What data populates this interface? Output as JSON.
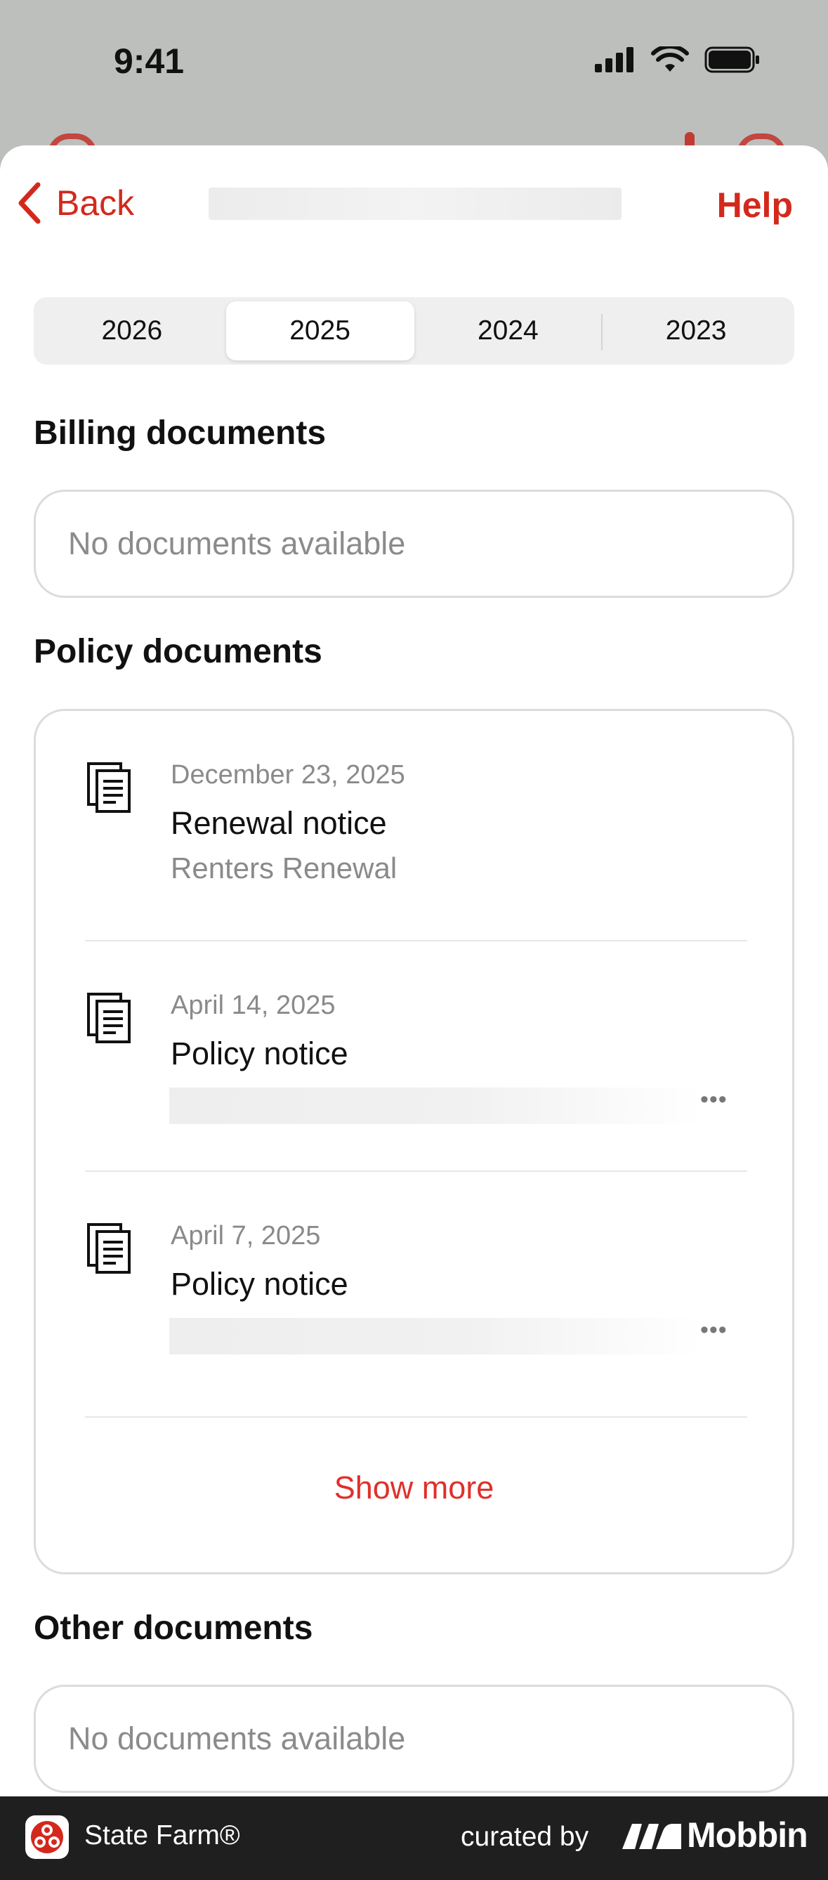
{
  "status_bar": {
    "time": "9:41"
  },
  "nav": {
    "back_label": "Back",
    "help_label": "Help"
  },
  "years": [
    {
      "label": "2026",
      "selected": false
    },
    {
      "label": "2025",
      "selected": true
    },
    {
      "label": "2024",
      "selected": false
    },
    {
      "label": "2023",
      "selected": false
    }
  ],
  "sections": {
    "billing": {
      "title": "Billing documents",
      "empty_text": "No documents available"
    },
    "policy": {
      "title": "Policy documents",
      "items": [
        {
          "date": "December 23, 2025",
          "title": "Renewal notice",
          "subtitle": "Renters Renewal",
          "icon": "document-icon"
        },
        {
          "date": "April 14, 2025",
          "title": "Policy notice",
          "subtitle": "",
          "icon": "document-icon"
        },
        {
          "date": "April 7, 2025",
          "title": "Policy notice",
          "subtitle": "",
          "icon": "document-icon"
        }
      ],
      "show_more_label": "Show more"
    },
    "other": {
      "title": "Other documents",
      "empty_text": "No documents available"
    }
  },
  "bottom_bar": {
    "brand": "State Farm®",
    "curated_by": "curated by",
    "mobbin": "Mobbin"
  },
  "colors": {
    "accent": "#d3291d",
    "bottom_bar": "#1f1f1f",
    "muted_text": "#8a8a8a"
  }
}
